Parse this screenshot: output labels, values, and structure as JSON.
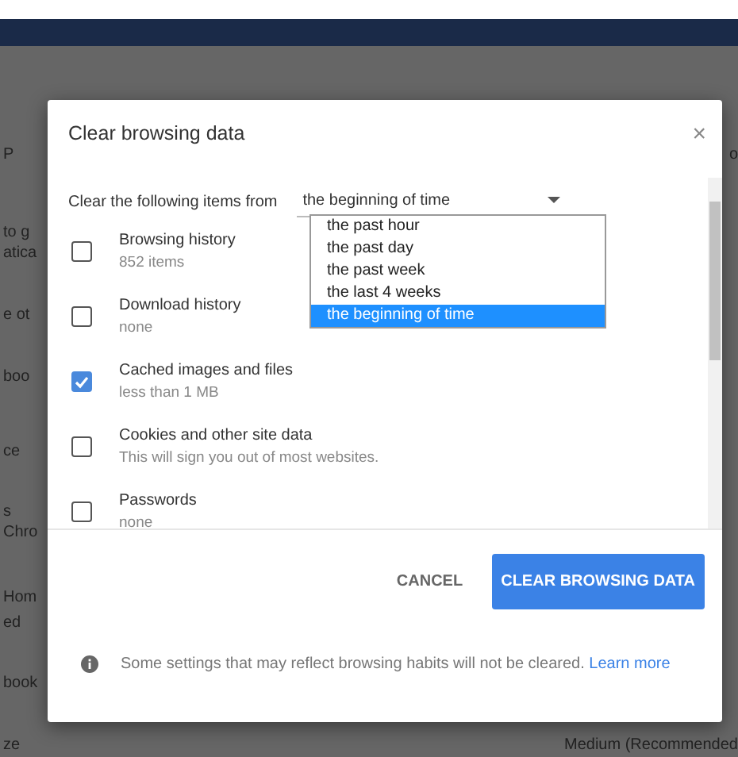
{
  "background_page": {
    "left_fragments": [
      "P",
      "to g",
      "atica",
      "e ot",
      "boo",
      "ce",
      "s",
      "Chro",
      "Hom",
      "ed",
      "book",
      "ze"
    ],
    "right_fragments": [
      "o",
      "Medium (Recommended"
    ]
  },
  "dialog": {
    "title": "Clear browsing data",
    "close": "×",
    "range": {
      "label": "Clear the following items from",
      "value": "the beginning of time",
      "expanded": true,
      "options": [
        {
          "label": "the past hour",
          "selected": false
        },
        {
          "label": "the past day",
          "selected": false
        },
        {
          "label": "the past week",
          "selected": false
        },
        {
          "label": "the last 4 weeks",
          "selected": false
        },
        {
          "label": "the beginning of time",
          "selected": true
        }
      ]
    },
    "items": [
      {
        "label": "Browsing history",
        "detail": "852 items",
        "checked": false
      },
      {
        "label": "Download history",
        "detail": "none",
        "checked": false
      },
      {
        "label": "Cached images and files",
        "detail": "less than 1 MB",
        "checked": true
      },
      {
        "label": "Cookies and other site data",
        "detail": "This will sign you out of most websites.",
        "checked": false
      },
      {
        "label": "Passwords",
        "detail": "none",
        "checked": false
      }
    ],
    "buttons": [
      {
        "label": "CANCEL",
        "kind": "text"
      },
      {
        "label": "CLEAR BROWSING DATA",
        "kind": "primary"
      }
    ],
    "note": {
      "text": "Some settings that may reflect browsing habits will not be cleared.",
      "link": "Learn more"
    }
  }
}
